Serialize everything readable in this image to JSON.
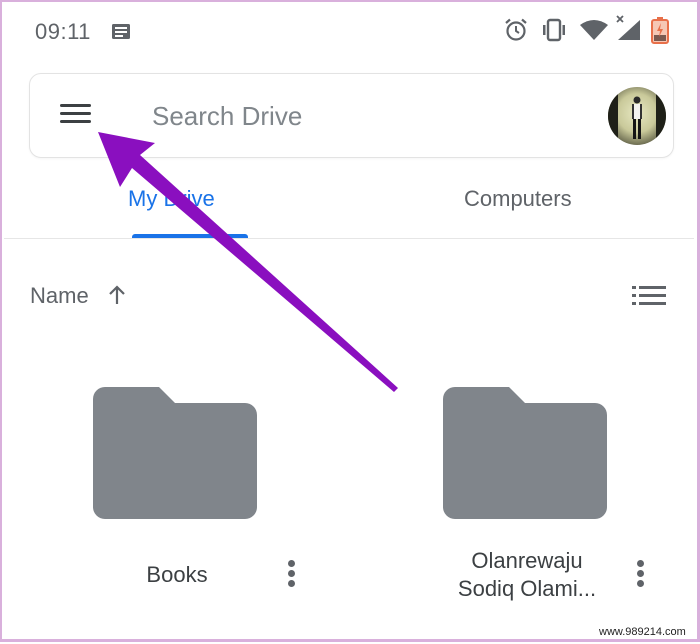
{
  "status_bar": {
    "time": "09:11",
    "left_icons": [
      "notification-icon"
    ],
    "right_icons": [
      "alarm-icon",
      "vibrate-icon",
      "wifi-icon",
      "signal-no-service-icon",
      "battery-charging-icon"
    ],
    "battery_color": "#e8704a"
  },
  "search": {
    "placeholder": "Search Drive",
    "value": "",
    "menu_icon": "hamburger-menu-icon",
    "account_icon": "account-avatar"
  },
  "tabs": [
    {
      "label": "My Drive",
      "active": true
    },
    {
      "label": "Computers",
      "active": false
    }
  ],
  "sort": {
    "label": "Name",
    "direction": "ascending",
    "view_toggle_icon": "list-view-icon"
  },
  "folders": [
    {
      "name_line1": "Books",
      "name_line2": ""
    },
    {
      "name_line1": "Olanrewaju",
      "name_line2": "Sodiq Olami..."
    }
  ],
  "annotation": {
    "type": "arrow",
    "color": "#8a0fbf",
    "points_to": "hamburger-menu-icon"
  },
  "watermark": "www.989214.com",
  "colors": {
    "accent": "#1a73e8",
    "folder": "#80858b",
    "text_secondary": "#5f6368"
  }
}
